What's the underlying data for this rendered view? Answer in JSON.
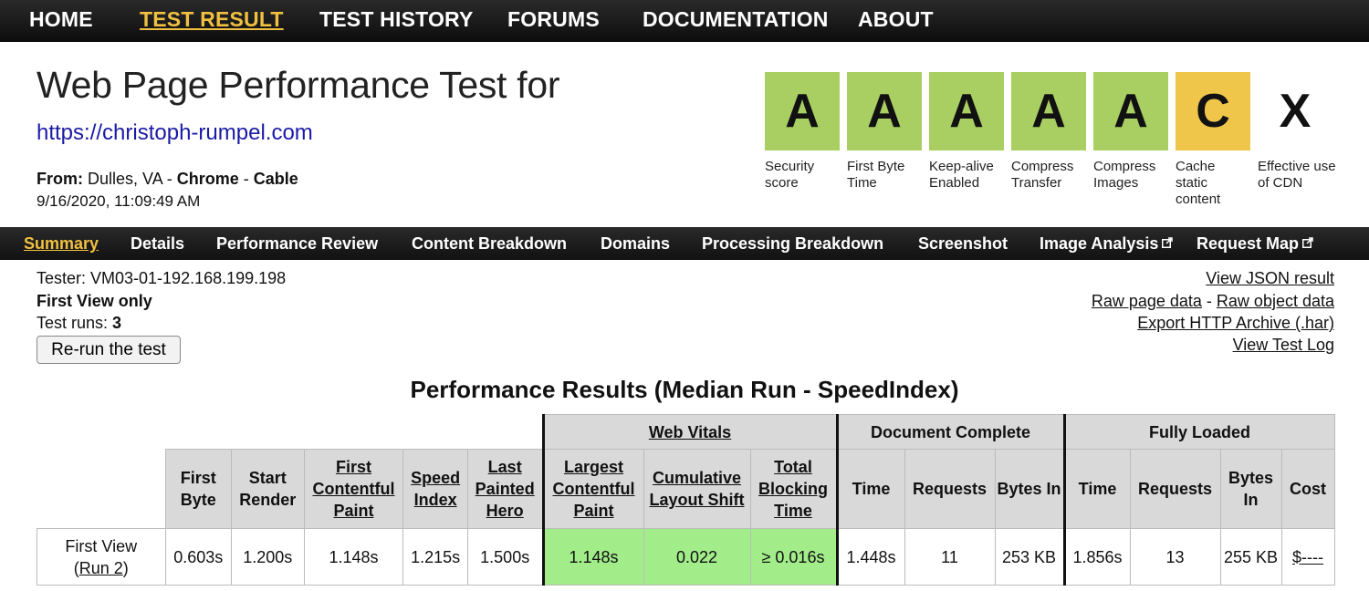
{
  "nav": {
    "home": "HOME",
    "test_result": "TEST RESULT",
    "test_history": "TEST HISTORY",
    "forums": "FORUMS",
    "documentation": "DOCUMENTATION",
    "about": "ABOUT"
  },
  "header": {
    "title": "Web Page Performance Test for",
    "url": "https://christoph-rumpel.com",
    "from_label": "From:",
    "location": "Dulles, VA",
    "browser": "Chrome",
    "connection": "Cable",
    "sep": " - ",
    "datetime": "9/16/2020, 11:09:49 AM"
  },
  "grades": [
    {
      "letter": "A",
      "label": "Security score",
      "color": "#a9cf62"
    },
    {
      "letter": "A",
      "label": "First Byte Time",
      "color": "#a9cf62"
    },
    {
      "letter": "A",
      "label": "Keep-alive Enabled",
      "color": "#a9cf62"
    },
    {
      "letter": "A",
      "label": "Compress Transfer",
      "color": "#a9cf62"
    },
    {
      "letter": "A",
      "label": "Compress Images",
      "color": "#a9cf62"
    },
    {
      "letter": "C",
      "label": "Cache static content",
      "color": "#f0c64a"
    },
    {
      "letter": "X",
      "label": "Effective use of CDN",
      "color": "none"
    }
  ],
  "subnav": {
    "summary": "Summary",
    "details": "Details",
    "performance_review": "Performance Review",
    "content_breakdown": "Content Breakdown",
    "domains": "Domains",
    "processing_breakdown": "Processing Breakdown",
    "screenshot": "Screenshot",
    "image_analysis": "Image Analysis",
    "request_map": "Request Map"
  },
  "info": {
    "tester": "Tester: VM03-01-192.168.199.198",
    "first_view_only": "First View only",
    "test_runs_label": "Test runs: ",
    "test_runs_value": "3",
    "rerun_button": "Re-run the test"
  },
  "links": {
    "view_json": "View JSON result",
    "raw_page_data": "Raw page data",
    "dash": " - ",
    "raw_object_data": "Raw object data",
    "export_har": "Export HTTP Archive (.har)",
    "view_test_log": "View Test Log"
  },
  "results": {
    "title": "Performance Results (Median Run - SpeedIndex)",
    "groups": {
      "web_vitals": "Web Vitals",
      "document_complete": "Document Complete",
      "fully_loaded": "Fully Loaded"
    },
    "headers": {
      "first_byte": "First Byte",
      "start_render": "Start Render",
      "first_contentful_paint": "First Contentful Paint",
      "speed_index": "Speed Index",
      "last_painted_hero": "Last Painted Hero",
      "largest_contentful_paint": "Largest Contentful Paint",
      "cumulative_layout_shift": "Cumulative Layout Shift",
      "total_blocking_time": "Total Blocking Time",
      "dc_time": "Time",
      "dc_requests": "Requests",
      "dc_bytes_in": "Bytes In",
      "fl_time": "Time",
      "fl_requests": "Requests",
      "fl_bytes_in": "Bytes In",
      "cost": "Cost"
    },
    "row": {
      "label": "First View",
      "run_open": "(",
      "run_link": "Run 2",
      "run_close": ")",
      "first_byte": "0.603s",
      "start_render": "1.200s",
      "first_contentful_paint": "1.148s",
      "speed_index": "1.215s",
      "last_painted_hero": "1.500s",
      "largest_contentful_paint": "1.148s",
      "cumulative_layout_shift": "0.022",
      "total_blocking_time": "≥ 0.016s",
      "dc_time": "1.448s",
      "dc_requests": "11",
      "dc_bytes_in": "253 KB",
      "fl_time": "1.856s",
      "fl_requests": "13",
      "fl_bytes_in": "255 KB",
      "cost": "$----"
    }
  },
  "colors": {
    "nav_active": "#f0c040",
    "grade_green": "#a9cf62",
    "grade_yellow": "#f0c64a",
    "vitals_highlight": "#a2ec8a",
    "url_link": "#1a1aa6"
  }
}
